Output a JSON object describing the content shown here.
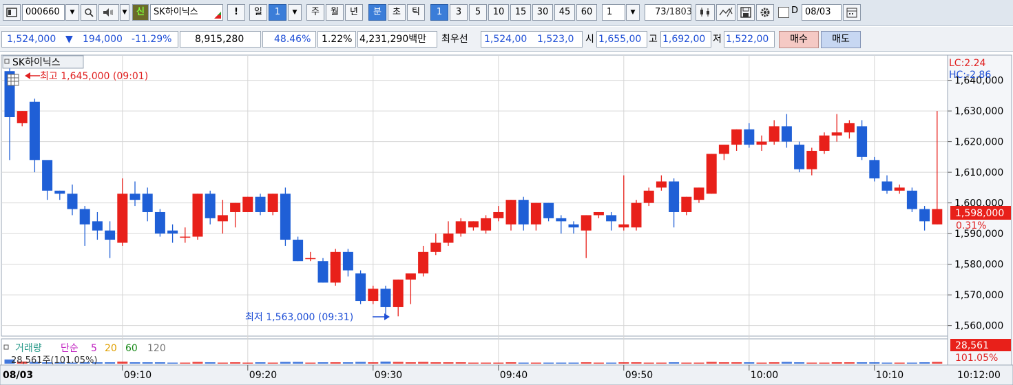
{
  "toolbar": {
    "code": "000660",
    "search_icon": "search-icon",
    "speaker_icon": "speaker-icon",
    "credit_badge": "신",
    "stock_name": "SK하이닉스",
    "alert": "!",
    "period_day": "일",
    "period_num": "1",
    "period_week": "주",
    "period_month": "월",
    "period_year": "년",
    "period_minute": "분",
    "period_second": "초",
    "period_tick": "틱",
    "intervals": [
      "1",
      "3",
      "5",
      "10",
      "15",
      "30",
      "45",
      "60"
    ],
    "interval_input": "1",
    "count_value": "73",
    "count_total": "/1803",
    "d_label": "D",
    "date_value": "08/03"
  },
  "quote": {
    "price": "1,524,000",
    "change_arrow": "▼",
    "change": "194,000",
    "change_pct": "-11.29%",
    "volume": "8,915,280",
    "vol_ratio": "48.46%",
    "turnover_rate": "1.22%",
    "amount": "4,231,290백만",
    "best_label": "최우선",
    "best_ask": "1,524,00",
    "best_bid": "1,523,0",
    "open_label": "시",
    "open": "1,655,00",
    "high_label": "고",
    "high": "1,692,00",
    "low_label": "저",
    "low": "1,522,00",
    "buy_button": "매수",
    "sell_button": "매도"
  },
  "chart": {
    "title": "SK하이닉스",
    "high_annotation": "최고 1,645,000 (09:01)",
    "low_annotation": "최저 1,563,000 (09:31)",
    "lc": "LC:2.24",
    "hc": "HC:-2.86",
    "current_price": "1,598,000",
    "current_pct": "0.31%",
    "volume_legend": {
      "title": "거래량",
      "ma_label": "단순",
      "ma5": "5",
      "ma20": "20",
      "ma60": "60",
      "ma120": "120"
    },
    "volume_sub": "28,561주(101.05%)",
    "volume_current": "28,561",
    "volume_pct": "101.05%",
    "date_label": "08/03",
    "end_time": "10:12:00",
    "colors": {
      "up": "#e8201a",
      "down": "#1f5fd6",
      "grid": "#d6d6d6"
    }
  },
  "chart_data": {
    "type": "candlestick",
    "y_ticks": [
      1560000,
      1570000,
      1580000,
      1590000,
      1600000,
      1610000,
      1620000,
      1630000,
      1640000
    ],
    "ylim": [
      1557000,
      1648000
    ],
    "x_ticks": [
      "09:10",
      "09:20",
      "09:30",
      "09:40",
      "09:50",
      "10:00",
      "10:10"
    ],
    "x_first": "09:01",
    "x_last": "10:12",
    "candles": [
      {
        "o": 1643000,
        "h": 1645000,
        "l": 1614000,
        "c": 1628000
      },
      {
        "o": 1626000,
        "h": 1630000,
        "l": 1625000,
        "c": 1630000
      },
      {
        "o": 1633000,
        "h": 1634000,
        "l": 1610000,
        "c": 1614000
      },
      {
        "o": 1614000,
        "h": 1613000,
        "l": 1601000,
        "c": 1604000
      },
      {
        "o": 1604000,
        "h": 1604000,
        "l": 1601000,
        "c": 1603000
      },
      {
        "o": 1603000,
        "h": 1606000,
        "l": 1596000,
        "c": 1598000
      },
      {
        "o": 1598000,
        "h": 1599000,
        "l": 1586000,
        "c": 1593000
      },
      {
        "o": 1594000,
        "h": 1597000,
        "l": 1588000,
        "c": 1591000
      },
      {
        "o": 1591000,
        "h": 1594000,
        "l": 1582000,
        "c": 1588000
      },
      {
        "o": 1587000,
        "h": 1608000,
        "l": 1586000,
        "c": 1603000
      },
      {
        "o": 1603000,
        "h": 1607000,
        "l": 1599000,
        "c": 1601000
      },
      {
        "o": 1603000,
        "h": 1605000,
        "l": 1594000,
        "c": 1597000
      },
      {
        "o": 1597000,
        "h": 1598000,
        "l": 1589000,
        "c": 1590000
      },
      {
        "o": 1591000,
        "h": 1593000,
        "l": 1587000,
        "c": 1590000
      },
      {
        "o": 1589000,
        "h": 1592000,
        "l": 1587000,
        "c": 1589000
      },
      {
        "o": 1589000,
        "h": 1603000,
        "l": 1588000,
        "c": 1603000
      },
      {
        "o": 1603000,
        "h": 1604000,
        "l": 1593000,
        "c": 1595000
      },
      {
        "o": 1594000,
        "h": 1601000,
        "l": 1590000,
        "c": 1596000
      },
      {
        "o": 1597000,
        "h": 1600000,
        "l": 1592000,
        "c": 1600000
      },
      {
        "o": 1597000,
        "h": 1602000,
        "l": 1597000,
        "c": 1602000
      },
      {
        "o": 1602000,
        "h": 1603000,
        "l": 1596000,
        "c": 1597000
      },
      {
        "o": 1597000,
        "h": 1603000,
        "l": 1596000,
        "c": 1603000
      },
      {
        "o": 1603000,
        "h": 1605000,
        "l": 1586000,
        "c": 1588000
      },
      {
        "o": 1588000,
        "h": 1589000,
        "l": 1581000,
        "c": 1581000
      },
      {
        "o": 1582000,
        "h": 1584000,
        "l": 1581000,
        "c": 1582000
      },
      {
        "o": 1581000,
        "h": 1582000,
        "l": 1574000,
        "c": 1574000
      },
      {
        "o": 1574000,
        "h": 1585000,
        "l": 1573000,
        "c": 1584000
      },
      {
        "o": 1584000,
        "h": 1585000,
        "l": 1576000,
        "c": 1578000
      },
      {
        "o": 1577000,
        "h": 1578000,
        "l": 1567000,
        "c": 1568000
      },
      {
        "o": 1568000,
        "h": 1573000,
        "l": 1567000,
        "c": 1572000
      },
      {
        "o": 1572000,
        "h": 1573000,
        "l": 1563000,
        "c": 1566000
      },
      {
        "o": 1566000,
        "h": 1575000,
        "l": 1563000,
        "c": 1575000
      },
      {
        "o": 1575000,
        "h": 1577000,
        "l": 1567000,
        "c": 1577000
      },
      {
        "o": 1577000,
        "h": 1586000,
        "l": 1576000,
        "c": 1584000
      },
      {
        "o": 1584000,
        "h": 1590000,
        "l": 1583000,
        "c": 1587000
      },
      {
        "o": 1587000,
        "h": 1594000,
        "l": 1586000,
        "c": 1590000
      },
      {
        "o": 1590000,
        "h": 1595000,
        "l": 1589000,
        "c": 1594000
      },
      {
        "o": 1592000,
        "h": 1594000,
        "l": 1591000,
        "c": 1594000
      },
      {
        "o": 1591000,
        "h": 1596000,
        "l": 1590000,
        "c": 1595000
      },
      {
        "o": 1595000,
        "h": 1599000,
        "l": 1594000,
        "c": 1597000
      },
      {
        "o": 1593000,
        "h": 1601000,
        "l": 1591000,
        "c": 1601000
      },
      {
        "o": 1601000,
        "h": 1602000,
        "l": 1591000,
        "c": 1593000
      },
      {
        "o": 1593000,
        "h": 1600000,
        "l": 1591000,
        "c": 1600000
      },
      {
        "o": 1600000,
        "h": 1600000,
        "l": 1594000,
        "c": 1595000
      },
      {
        "o": 1595000,
        "h": 1596000,
        "l": 1590000,
        "c": 1594000
      },
      {
        "o": 1593000,
        "h": 1594000,
        "l": 1590000,
        "c": 1592000
      },
      {
        "o": 1591000,
        "h": 1596000,
        "l": 1582000,
        "c": 1596000
      },
      {
        "o": 1596000,
        "h": 1597000,
        "l": 1595000,
        "c": 1597000
      },
      {
        "o": 1596000,
        "h": 1597000,
        "l": 1591000,
        "c": 1594000
      },
      {
        "o": 1592000,
        "h": 1609000,
        "l": 1591000,
        "c": 1593000
      },
      {
        "o": 1592000,
        "h": 1601000,
        "l": 1591000,
        "c": 1600000
      },
      {
        "o": 1600000,
        "h": 1605000,
        "l": 1599000,
        "c": 1604000
      },
      {
        "o": 1605000,
        "h": 1609000,
        "l": 1604000,
        "c": 1607000
      },
      {
        "o": 1607000,
        "h": 1608000,
        "l": 1592000,
        "c": 1597000
      },
      {
        "o": 1597000,
        "h": 1602000,
        "l": 1596000,
        "c": 1602000
      },
      {
        "o": 1601000,
        "h": 1605000,
        "l": 1600000,
        "c": 1605000
      },
      {
        "o": 1603000,
        "h": 1616000,
        "l": 1603000,
        "c": 1616000
      },
      {
        "o": 1616000,
        "h": 1619000,
        "l": 1614000,
        "c": 1619000
      },
      {
        "o": 1619000,
        "h": 1624000,
        "l": 1617000,
        "c": 1624000
      },
      {
        "o": 1624000,
        "h": 1626000,
        "l": 1618000,
        "c": 1619000
      },
      {
        "o": 1619000,
        "h": 1622000,
        "l": 1617000,
        "c": 1620000
      },
      {
        "o": 1620000,
        "h": 1627000,
        "l": 1619000,
        "c": 1625000
      },
      {
        "o": 1625000,
        "h": 1629000,
        "l": 1618000,
        "c": 1620000
      },
      {
        "o": 1619000,
        "h": 1620000,
        "l": 1610000,
        "c": 1611000
      },
      {
        "o": 1611000,
        "h": 1618000,
        "l": 1609000,
        "c": 1617000
      },
      {
        "o": 1617000,
        "h": 1623000,
        "l": 1616000,
        "c": 1622000
      },
      {
        "o": 1622000,
        "h": 1629000,
        "l": 1620000,
        "c": 1623000
      },
      {
        "o": 1623000,
        "h": 1627000,
        "l": 1621000,
        "c": 1626000
      },
      {
        "o": 1625000,
        "h": 1627000,
        "l": 1614000,
        "c": 1615000
      },
      {
        "o": 1614000,
        "h": 1615000,
        "l": 1607000,
        "c": 1608000
      },
      {
        "o": 1607000,
        "h": 1609000,
        "l": 1603000,
        "c": 1604000
      },
      {
        "o": 1604000,
        "h": 1606000,
        "l": 1603000,
        "c": 1605000
      },
      {
        "o": 1604000,
        "h": 1605000,
        "l": 1597000,
        "c": 1598000
      },
      {
        "o": 1598000,
        "h": 1599000,
        "l": 1591000,
        "c": 1594000
      },
      {
        "o": 1593000,
        "h": 1630000,
        "l": 1593000,
        "c": 1598000
      }
    ],
    "volume": [
      0.6,
      0.3,
      0.25,
      0.2,
      0.2,
      0.15,
      0.2,
      0.2,
      0.2,
      0.3,
      0.2,
      0.2,
      0.2,
      0.15,
      0.15,
      0.25,
      0.2,
      0.15,
      0.2,
      0.15,
      0.2,
      0.15,
      0.25,
      0.25,
      0.15,
      0.2,
      0.2,
      0.2,
      0.25,
      0.2,
      0.3,
      0.25,
      0.2,
      0.25,
      0.2,
      0.2,
      0.2,
      0.15,
      0.15,
      0.15,
      0.2,
      0.15,
      0.15,
      0.15,
      0.15,
      0.15,
      0.2,
      0.15,
      0.15,
      0.2,
      0.2,
      0.15,
      0.15,
      0.2,
      0.15,
      0.15,
      0.25,
      0.2,
      0.2,
      0.2,
      0.15,
      0.2,
      0.25,
      0.2,
      0.15,
      0.15,
      0.2,
      0.2,
      0.2,
      0.2,
      0.15,
      0.15,
      0.15,
      0.2,
      0.25
    ]
  }
}
